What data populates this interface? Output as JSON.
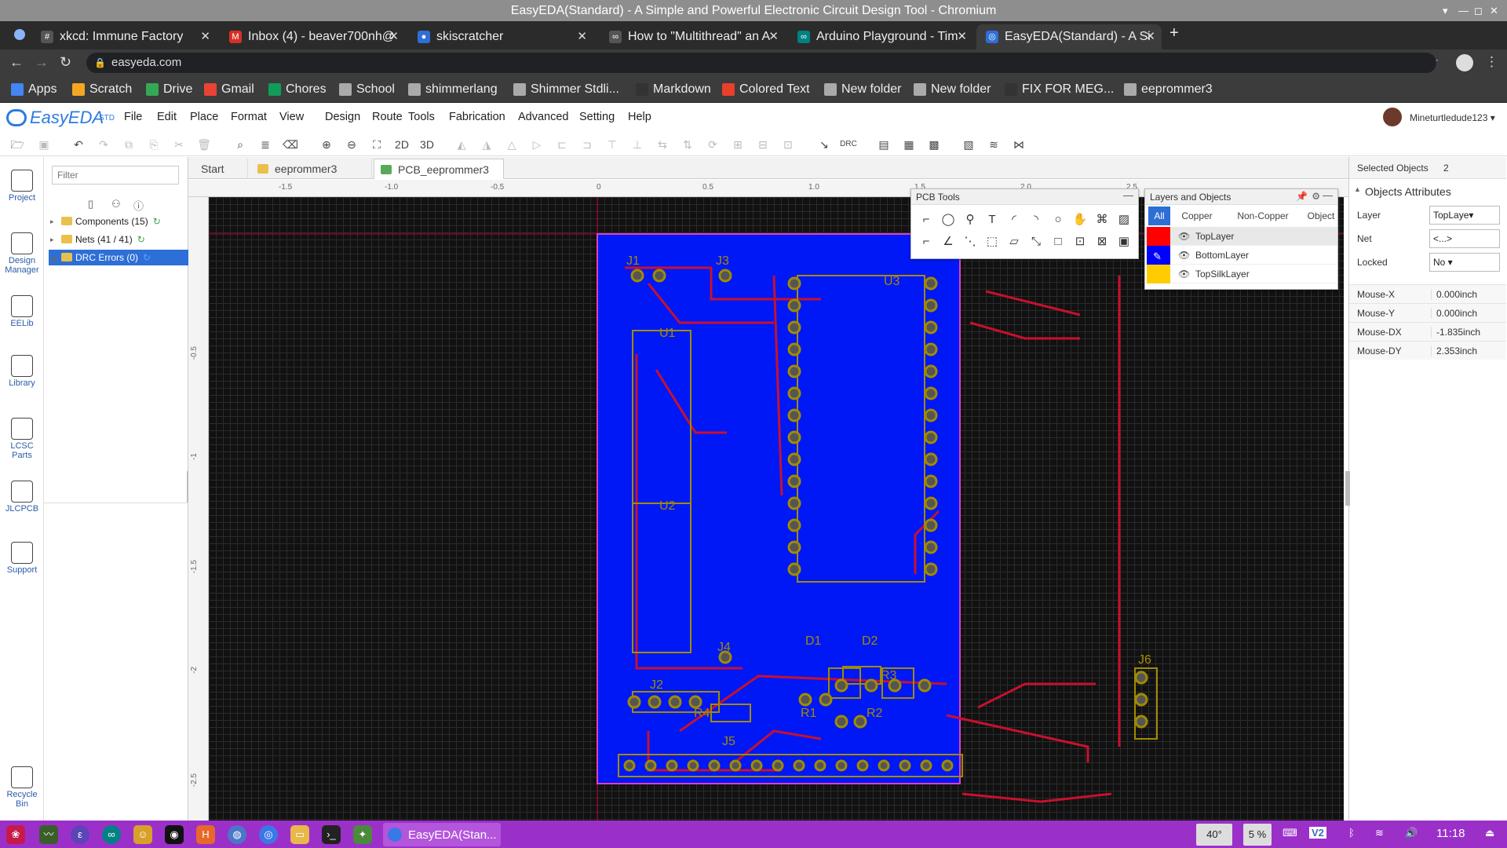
{
  "window": {
    "title": "EasyEDA(Standard) - A Simple and Powerful Electronic Circuit Design Tool - Chromium"
  },
  "browser": {
    "tabs": [
      {
        "label": "xkcd: Immune Factory",
        "fav": "#",
        "color": "#555"
      },
      {
        "label": "Inbox (4) - beaver700nh@",
        "fav": "M",
        "color": "#d93025"
      },
      {
        "label": "skiscratcher",
        "fav": "●",
        "color": "#2d6fd6"
      },
      {
        "label": "How to \"Multithread\" an A",
        "fav": "∞",
        "color": "#555"
      },
      {
        "label": "Arduino Playground - Tim",
        "fav": "∞",
        "color": "#008184"
      },
      {
        "label": "EasyEDA(Standard) - A Si",
        "fav": "◎",
        "color": "#2d6fd6"
      }
    ],
    "new_tab": "+",
    "address": "easyeda.com",
    "bookmarks": [
      {
        "label": "Apps",
        "color": "#4285f4"
      },
      {
        "label": "Scratch",
        "color": "#f5a623"
      },
      {
        "label": "Drive",
        "color": "#34a853"
      },
      {
        "label": "Gmail",
        "color": "#ea4335"
      },
      {
        "label": "Chores",
        "color": "#0f9d58"
      },
      {
        "label": "School",
        "color": "#aaa"
      },
      {
        "label": "shimmerlang",
        "color": "#aaa"
      },
      {
        "label": "Shimmer Stdli...",
        "color": "#aaa"
      },
      {
        "label": "Markdown",
        "color": "#333"
      },
      {
        "label": "Colored Text",
        "color": "#e8402b"
      },
      {
        "label": "New folder",
        "color": "#aaa"
      },
      {
        "label": "New folder",
        "color": "#aaa"
      },
      {
        "label": "FIX FOR MEG...",
        "color": "#333"
      },
      {
        "label": "eeprommer3",
        "color": "#aaa"
      }
    ]
  },
  "app": {
    "logo": "EasyEDA",
    "logo_sub": "STD",
    "menus": [
      "File",
      "Edit",
      "Place",
      "Format",
      "View",
      "Design",
      "Route",
      "Tools",
      "Fabrication",
      "Advanced",
      "Setting",
      "Help"
    ],
    "user": "Mineturtledude123 ▾",
    "toolbar_text": {
      "view2d": "2D",
      "view3d": "3D",
      "drc": "DRC"
    }
  },
  "rail": [
    {
      "label": "Project"
    },
    {
      "label": "Design Manager"
    },
    {
      "label": "EELib"
    },
    {
      "label": "Library"
    },
    {
      "label": "LCSC Parts"
    },
    {
      "label": "JLCPCB"
    },
    {
      "label": "Support"
    },
    {
      "label": "Recycle Bin"
    }
  ],
  "design_manager": {
    "filter_placeholder": "Filter",
    "items": [
      {
        "label": "Components (15)",
        "selected": false
      },
      {
        "label": "Nets (41 / 41)",
        "selected": false
      },
      {
        "label": "DRC Errors (0)",
        "selected": true
      }
    ]
  },
  "doc_tabs": [
    {
      "label": "Start"
    },
    {
      "label": "eeprommer3"
    },
    {
      "label": "PCB_eeprommer3"
    }
  ],
  "ruler": {
    "top": [
      "-1.5",
      "-1.0",
      "-0.5",
      "0",
      "0.5",
      "1.0",
      "1.5",
      "2.0",
      "2.5"
    ],
    "left": [
      "-0.5",
      "-1",
      "-1.5",
      "-2",
      "-2.5"
    ]
  },
  "pcb": {
    "labels": [
      "J1",
      "J3",
      "U1",
      "U3",
      "U2",
      "D1",
      "D2",
      "J4",
      "J6",
      "J2",
      "R3",
      "R1",
      "R2",
      "R4",
      "J5"
    ],
    "colors": {
      "board": "#0018f5",
      "top": "#c8102e",
      "silk": "#a08b00",
      "outline": "#e040c0"
    }
  },
  "pcb_tools": {
    "title": "PCB Tools"
  },
  "layers_panel": {
    "title": "Layers and Objects",
    "tabs": [
      "All",
      "Copper",
      "Non-Copper",
      "Object"
    ],
    "layers": [
      {
        "name": "TopLayer",
        "color": "#ff0000"
      },
      {
        "name": "BottomLayer",
        "color": "#0000ff"
      },
      {
        "name": "TopSilkLayer",
        "color": "#ffcc00"
      }
    ]
  },
  "properties": {
    "selected_label": "Selected Objects",
    "selected_count": "2",
    "section": "Objects Attributes",
    "rows": [
      {
        "label": "Layer",
        "value": "TopLaye▾"
      },
      {
        "label": "Net",
        "value": "<...>"
      },
      {
        "label": "Locked",
        "value": "No ▾"
      }
    ],
    "mouse": [
      {
        "label": "Mouse-X",
        "value": "0.000inch"
      },
      {
        "label": "Mouse-Y",
        "value": "0.000inch"
      },
      {
        "label": "Mouse-DX",
        "value": "-1.835inch"
      },
      {
        "label": "Mouse-DY",
        "value": "2.353inch"
      }
    ]
  },
  "taskbar": {
    "window_label": "EasyEDA(Stan...",
    "temp": "40°",
    "percent": "5 %",
    "clock": "11:18"
  }
}
